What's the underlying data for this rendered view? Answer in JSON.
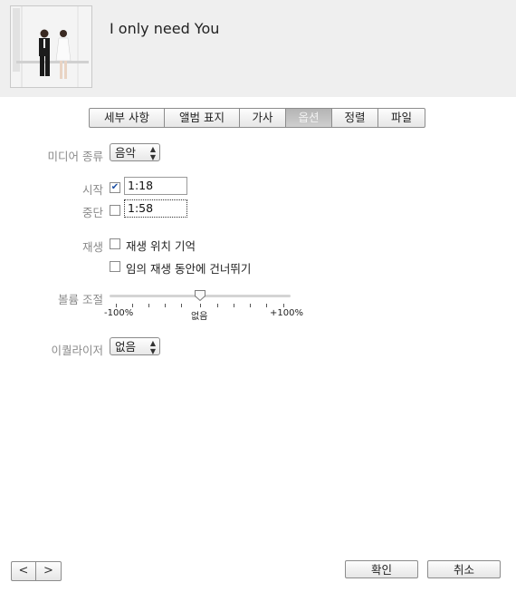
{
  "header": {
    "title": "I only need You"
  },
  "tabs": [
    {
      "label": "세부 사항"
    },
    {
      "label": "앨범 표지"
    },
    {
      "label": "가사"
    },
    {
      "label": "옵션"
    },
    {
      "label": "정렬"
    },
    {
      "label": "파일"
    }
  ],
  "active_tab": "옵션",
  "media_kind": {
    "label": "미디어 종류",
    "value": "음악"
  },
  "start": {
    "label": "시작",
    "checked": true,
    "value": "1:18"
  },
  "stop": {
    "label": "중단",
    "checked": false,
    "value": "1:58"
  },
  "playback": {
    "label": "재생",
    "remember_position": {
      "label": "재생 위치 기억",
      "checked": false
    },
    "skip_shuffle": {
      "label": "임의 재생 동안에 건너뛰기",
      "checked": false
    }
  },
  "volume": {
    "label": "볼륨 조절",
    "value_percent": 0,
    "min_label": "-100%",
    "mid_label": "없음",
    "max_label": "+100%"
  },
  "equalizer": {
    "label": "이퀄라이저",
    "value": "없음"
  },
  "footer": {
    "prev_icon": "chevron-left-icon",
    "next_icon": "chevron-right-icon",
    "prev_glyph": "<",
    "next_glyph": ">",
    "ok_label": "확인",
    "cancel_label": "취소"
  }
}
